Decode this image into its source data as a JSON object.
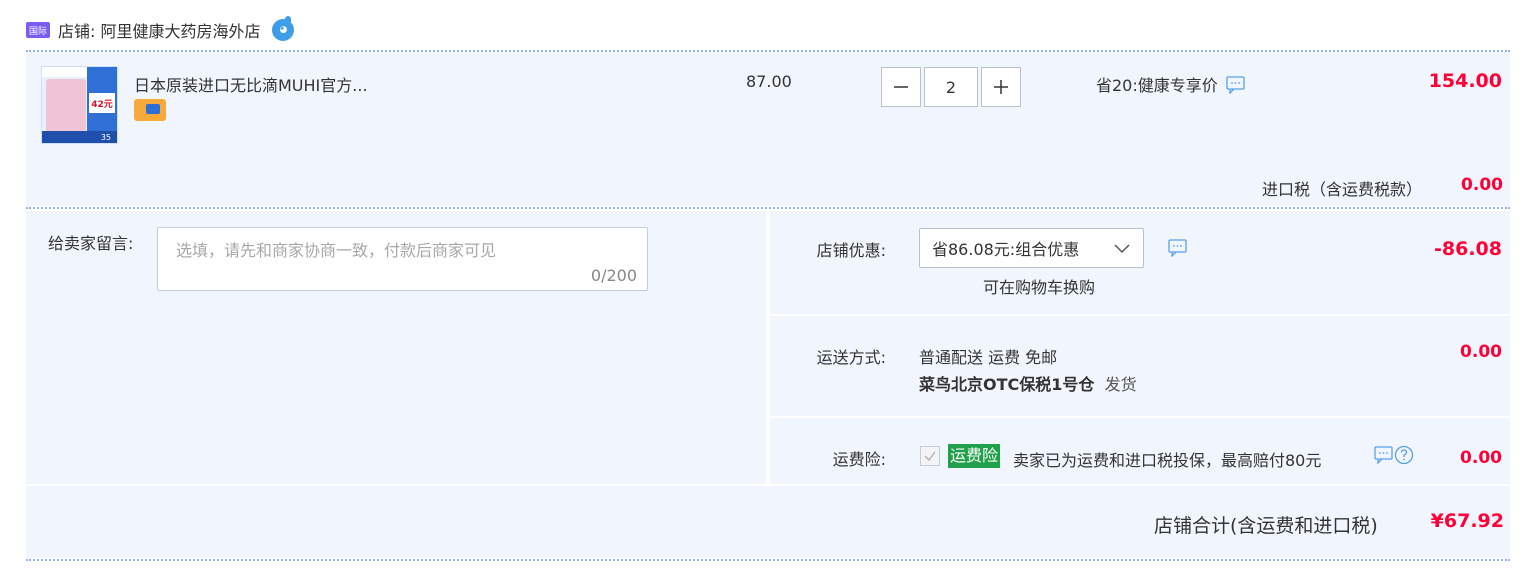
{
  "shop": {
    "tag": "国际",
    "name": "店铺: 阿里健康大药房海外店"
  },
  "item": {
    "thumb": {
      "top_label": "进口日",
      "price_badge": "42元",
      "bottom_label": "35"
    },
    "title": "日本原装进口无比滴MUHI官方...",
    "unit_price": "87.00",
    "quantity": "2",
    "minus": "—",
    "plus": "+",
    "promo": "省20:健康专享价",
    "total": "154.00"
  },
  "tax": {
    "label": "进口税（含运费税款）",
    "value": "0.00"
  },
  "message": {
    "label": "给卖家留言:",
    "placeholder": "选填，请先和商家协商一致，付款后商家可见",
    "counter": "0/200"
  },
  "discount": {
    "label": "店铺优惠:",
    "selected": "省86.08元:组合优惠",
    "note": "可在购物车换购",
    "value": "-86.08"
  },
  "shipping": {
    "label": "运送方式:",
    "method": "普通配送 运费 免邮",
    "warehouse": "菜鸟北京OTC保税1号仓",
    "ship_text": "发货",
    "value": "0.00"
  },
  "insurance": {
    "label": "运费险:",
    "badge": "运费险",
    "text": "卖家已为运费和进口税投保，最高赔付80元",
    "value": "0.00"
  },
  "summary": {
    "label": "店铺合计(含运费和进口税)",
    "value": "¥67.92"
  },
  "colors": {
    "accent_red": "#ff0036",
    "panel_bg": "#f1f6fe",
    "badge_green": "#20a04a",
    "link_blue": "#3d9de8"
  },
  "icons": {
    "chat": "chat-bubble-icon",
    "help": "question-circle-icon",
    "dropdown": "chevron-down-icon"
  }
}
